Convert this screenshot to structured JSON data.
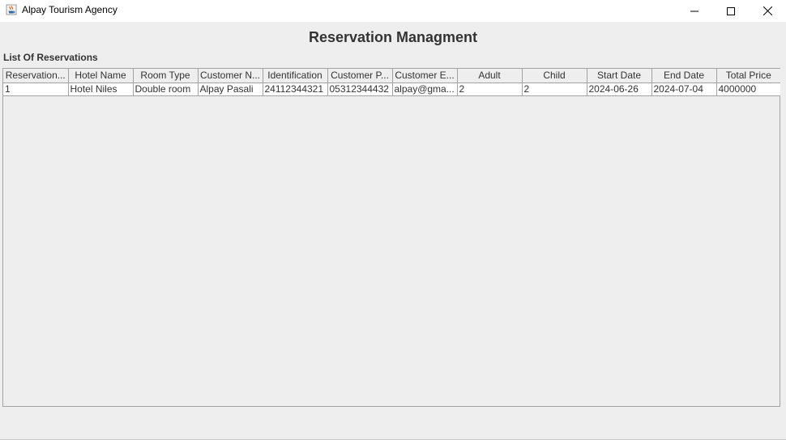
{
  "window": {
    "title": "Alpay Tourism Agency",
    "icon": "java-icon",
    "controls": [
      "minimize-icon",
      "maximize-icon",
      "close-icon"
    ]
  },
  "page": {
    "heading": "Reservation Managment",
    "list_label": "List Of Reservations"
  },
  "table": {
    "columns": [
      "Reservation...",
      "Hotel Name",
      "Room Type",
      "Customer N...",
      "Identification",
      "Customer P...",
      "Customer E...",
      "Adult",
      "Child",
      "Start Date",
      "End Date",
      "Total Price"
    ],
    "rows": [
      [
        "1",
        "Hotel Niles",
        "Double room",
        "Alpay Pasali",
        "24112344321",
        "05312344432",
        "alpay@gma...",
        "2",
        "2",
        "2024-06-26",
        "2024-07-04",
        "4000000"
      ]
    ]
  },
  "colors": {
    "window_background": "#eeeeee",
    "titlebar_background": "#ffffff",
    "grid_line": "#a3a3a3",
    "text": "#333333"
  }
}
